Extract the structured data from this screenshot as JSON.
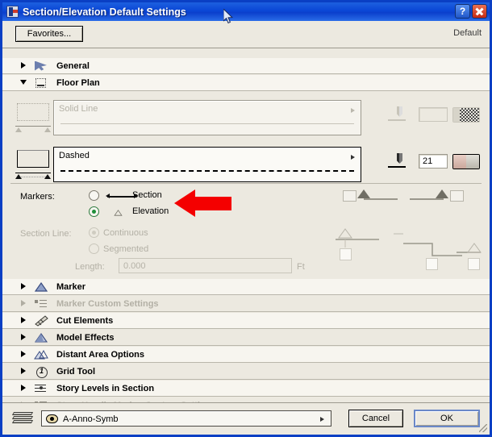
{
  "window": {
    "title": "Section/Elevation Default Settings",
    "app_icon": "archicad-section-icon",
    "help_button": "?",
    "close_button": "close-icon"
  },
  "toolbar": {
    "favorites_label": "Favorites...",
    "default_label": "Default"
  },
  "tree_top": [
    {
      "label": "General",
      "icon": "arrow-tool-icon",
      "expanded": false,
      "enabled": true
    },
    {
      "label": "Floor Plan",
      "icon": "floor-plan-icon",
      "expanded": true,
      "enabled": true
    }
  ],
  "floor_plan": {
    "uncut_line": {
      "style_name": "Solid Line",
      "enabled": false,
      "pen_icon": "pen-icon",
      "pen_number": "",
      "swatch": "line-type-swatch"
    },
    "cut_line": {
      "style_name": "Dashed",
      "enabled": true,
      "pen_icon": "pen-icon",
      "pen_number": "21",
      "swatch": "line-type-swatch"
    },
    "markers": {
      "label": "Markers:",
      "options": [
        {
          "label": "Section",
          "glyph": "section-marker-glyph",
          "selected": false
        },
        {
          "label": "Elevation",
          "glyph": "elevation-marker-glyph",
          "selected": true
        }
      ]
    },
    "section_line": {
      "label": "Section Line:",
      "enabled": false,
      "options": [
        {
          "label": "Continuous",
          "selected": true
        },
        {
          "label": "Segmented",
          "selected": false
        }
      ],
      "length_label": "Length:",
      "length_value": "0.000",
      "length_unit": "Ft"
    }
  },
  "tree_bottom": [
    {
      "label": "Marker",
      "icon": "marker-triangle-icon",
      "enabled": true
    },
    {
      "label": "Marker Custom Settings",
      "icon": "custom-settings-icon",
      "enabled": false
    },
    {
      "label": "Cut Elements",
      "icon": "cut-elements-icon",
      "enabled": true
    },
    {
      "label": "Model Effects",
      "icon": "model-effects-icon",
      "enabled": true
    },
    {
      "label": "Distant Area Options",
      "icon": "distant-area-icon",
      "enabled": true
    },
    {
      "label": "Grid Tool",
      "icon": "grid-tool-icon",
      "enabled": true
    },
    {
      "label": "Story Levels in Section",
      "icon": "story-levels-icon",
      "enabled": true
    },
    {
      "label": "Story Handle Marker Custom Settings",
      "icon": "custom-settings-icon",
      "enabled": false
    }
  ],
  "footer": {
    "layer_icon": "layers-icon",
    "layer_eye_icon": "eye-icon",
    "layer_value": "A-Anno-Symb",
    "cancel_label": "Cancel",
    "ok_label": "OK"
  },
  "annotation": {
    "arrow": "red-left-arrow",
    "arrow_color": "#f40000"
  },
  "colors": {
    "titlebar": "#0a46d6",
    "dialog_bg": "#ece9e0",
    "row_bg": "#f7f5ef",
    "disabled_text": "#b3b0a5",
    "selected_radio": "#1f8f3a"
  }
}
